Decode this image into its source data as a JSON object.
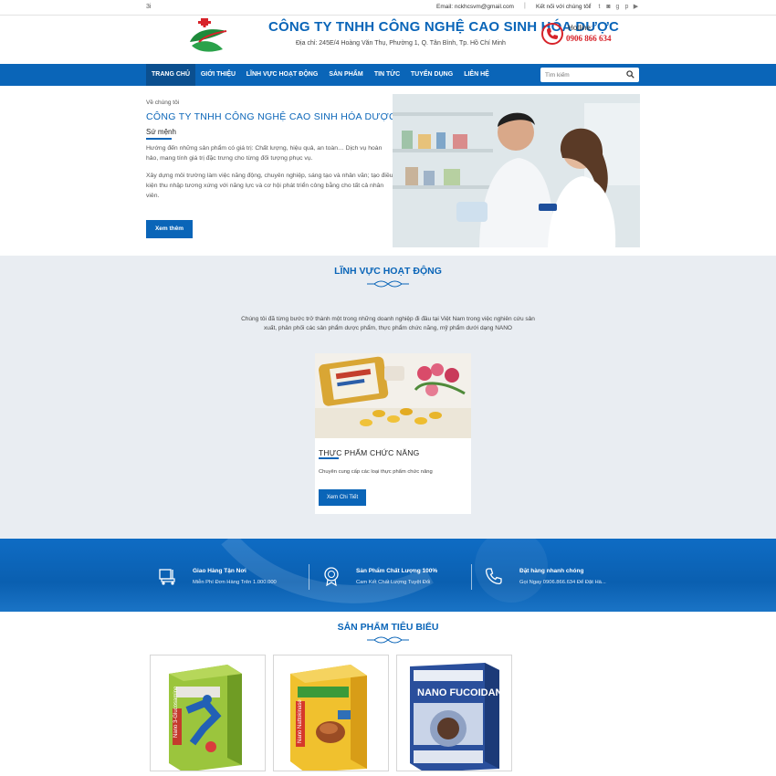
{
  "topbar": {
    "left_mark": "3i",
    "email": "Email: nckhcsvm@gmail.com",
    "separator": "|",
    "connect_label": "Kết nối với chúng tôi",
    "socials": [
      "facebook-icon",
      "twitter-icon",
      "instagram-icon",
      "google-plus-icon",
      "pinterest-icon",
      "youtube-icon"
    ]
  },
  "header": {
    "company_name": "CÔNG TY TNHH CÔNG NGHỆ CAO SINH HÓA DƯỢC",
    "address": "Địa chỉ: 245E/4 Hoàng Văn Thụ, Phường 1, Q. Tân Bình, Tp. Hồ Chí Minh",
    "hotline_label": "Hotline:",
    "hotline_number": "0906 866 634"
  },
  "nav": {
    "items": [
      {
        "label": "TRANG CHỦ",
        "active": true
      },
      {
        "label": "GIỚI THIỆU",
        "active": false
      },
      {
        "label": "LĨNH VỰC HOẠT ĐỘNG",
        "active": false
      },
      {
        "label": "SẢN PHẨM",
        "active": false
      },
      {
        "label": "TIN TỨC",
        "active": false
      },
      {
        "label": "TUYỂN DỤNG",
        "active": false
      },
      {
        "label": "LIÊN HỆ",
        "active": false
      }
    ],
    "search_placeholder": "Tìm kiếm"
  },
  "about": {
    "eyebrow": "Về chúng tôi",
    "title": "CÔNG TY TNHH CÔNG NGHỆ CAO SINH HÓA DƯỢC",
    "subtitle": "Sứ mệnh",
    "paragraph1": "Hướng đến những sản phẩm có giá trị: Chất lượng, hiệu quả, an toàn… Dịch vụ hoàn hảo, mang tính giá trị đặc trưng cho từng đối tượng phục vụ.",
    "paragraph2": "Xây dựng môi trường làm việc năng động, chuyên nghiệp, sáng tạo và nhân văn; tạo điều kiện thu nhập tương xứng với năng lực và cơ hội phát triển công bằng cho tất cả nhân viên.",
    "button": "Xem thêm"
  },
  "fields": {
    "title": "LĨNH VỰC HOẠT ĐỘNG",
    "description": "Chúng tôi đã từng bước trở thành một trong những doanh nghiệp đi đầu tại Việt Nam trong việc nghiên cứu sản xuất, phân phối các sản phẩm dược phẩm, thực phẩm chức năng, mỹ phẩm dưới dạng NANO",
    "card": {
      "title": "THỰC PHẨM CHỨC NĂNG",
      "description": "Chuyên cung cấp các loại thực phẩm chức năng",
      "button": "Xem Chi Tiết"
    }
  },
  "features": [
    {
      "icon": "delivery-icon",
      "title": "Giao Hàng Tận Nơi",
      "subtitle": "Miễn Phí Đơn Hàng Trên 1.000.000"
    },
    {
      "icon": "quality-badge-icon",
      "title": "Sản Phẩm Chất Lượng 100%",
      "subtitle": "Cam Kết Chất Lượng Tuyệt Đối"
    },
    {
      "icon": "phone-icon",
      "title": "Đặt hàng nhanh chóng",
      "subtitle": "Gọi Ngay 0906.866.634 Để Đặt Hà..."
    }
  ],
  "products": {
    "title": "SẢN PHẨM TIÊU BIỂU",
    "items": [
      {
        "box_text": "Nano 3-Glucosamine"
      },
      {
        "box_text": "Nano Nattokinase"
      },
      {
        "box_text": "NANO FUCOIDAN"
      }
    ]
  },
  "colors": {
    "brand_blue": "#0a65b8",
    "nav_active": "#0b4f8f",
    "accent_red": "#d7232a",
    "section_gray": "#e9edf2"
  }
}
